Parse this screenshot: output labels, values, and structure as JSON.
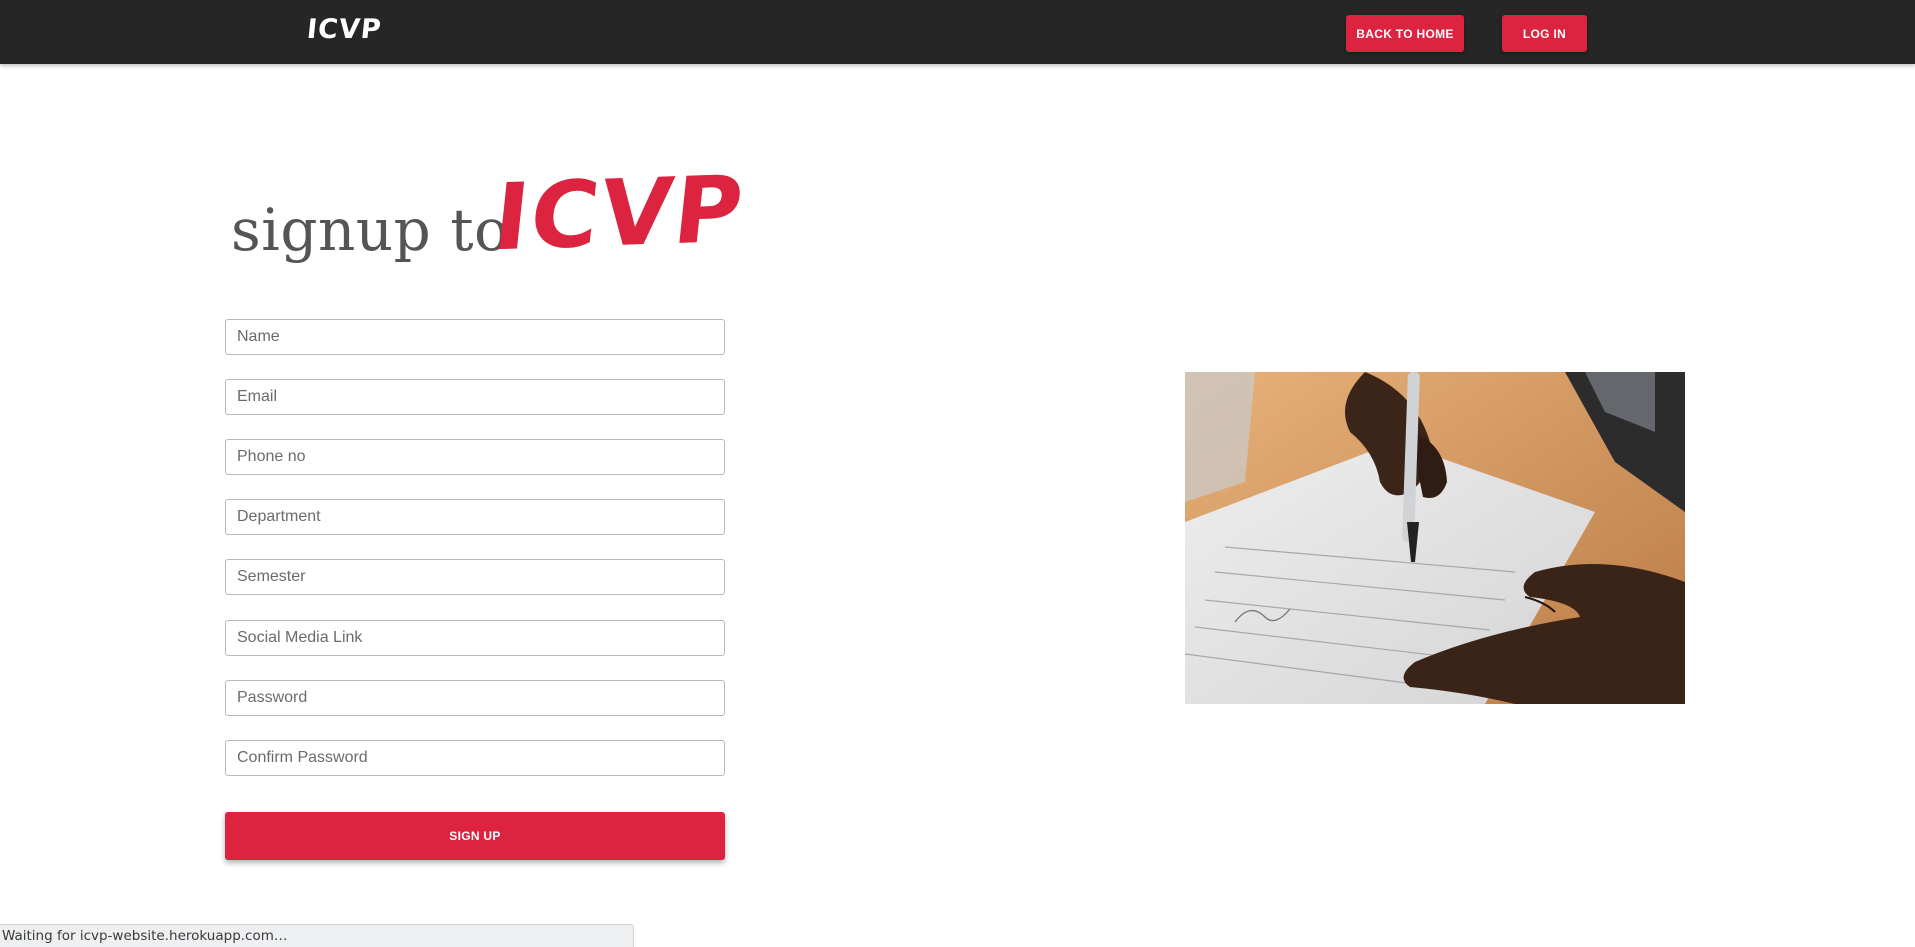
{
  "navbar": {
    "logo": "ICVP",
    "back_home_label": "BACK TO HOME",
    "login_label": "LOG IN"
  },
  "heading": {
    "prefix": "signup to",
    "brand": "ICVP"
  },
  "form": {
    "fields": [
      {
        "placeholder": "Name",
        "value": ""
      },
      {
        "placeholder": "Email",
        "value": ""
      },
      {
        "placeholder": "Phone no",
        "value": ""
      },
      {
        "placeholder": "Department",
        "value": ""
      },
      {
        "placeholder": "Semester",
        "value": ""
      },
      {
        "placeholder": "Social Media Link",
        "value": ""
      },
      {
        "placeholder": "Password",
        "value": ""
      },
      {
        "placeholder": "Confirm Password",
        "value": ""
      }
    ],
    "submit_label": "SIGN UP"
  },
  "image": {
    "icon": "document-signing-photo"
  },
  "status_bar": {
    "text": "Waiting for icvp-website.herokuapp.com…"
  },
  "colors": {
    "accent": "#dc2340",
    "navbar_bg": "#262626"
  }
}
